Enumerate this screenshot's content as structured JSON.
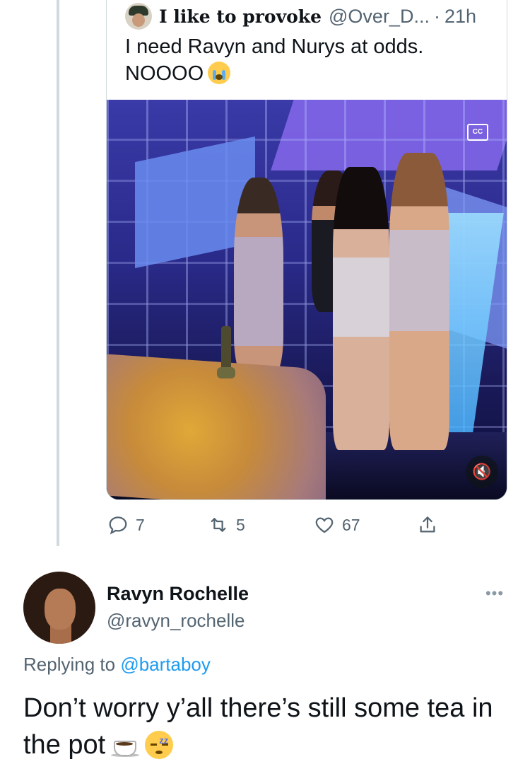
{
  "quoted_tweet": {
    "display_name": "I like to provoke",
    "handle": "@Over_D...",
    "separator": "·",
    "time": "21h",
    "text_line1": "I need Ravyn and Nurys at odds.",
    "text_line2": "NOOOO",
    "emoji": "loudly-crying-face",
    "video": {
      "captions_label": "CC",
      "mute_icon": "🔇"
    }
  },
  "actions": {
    "reply_count": "7",
    "retweet_count": "5",
    "like_count": "67"
  },
  "main_tweet": {
    "display_name": "Ravyn Rochelle",
    "handle": "@ravyn_rochelle",
    "more_label": "•••",
    "replying_prefix": "Replying to",
    "replying_handle": "@bartaboy",
    "text": "Don’t worry y’all there’s still some tea in the pot",
    "emojis": [
      "hot-beverage",
      "sleeping-face"
    ]
  },
  "colors": {
    "text_primary": "#0f1419",
    "text_secondary": "#536471",
    "link": "#1d9bf0",
    "border": "#cfd9de"
  }
}
